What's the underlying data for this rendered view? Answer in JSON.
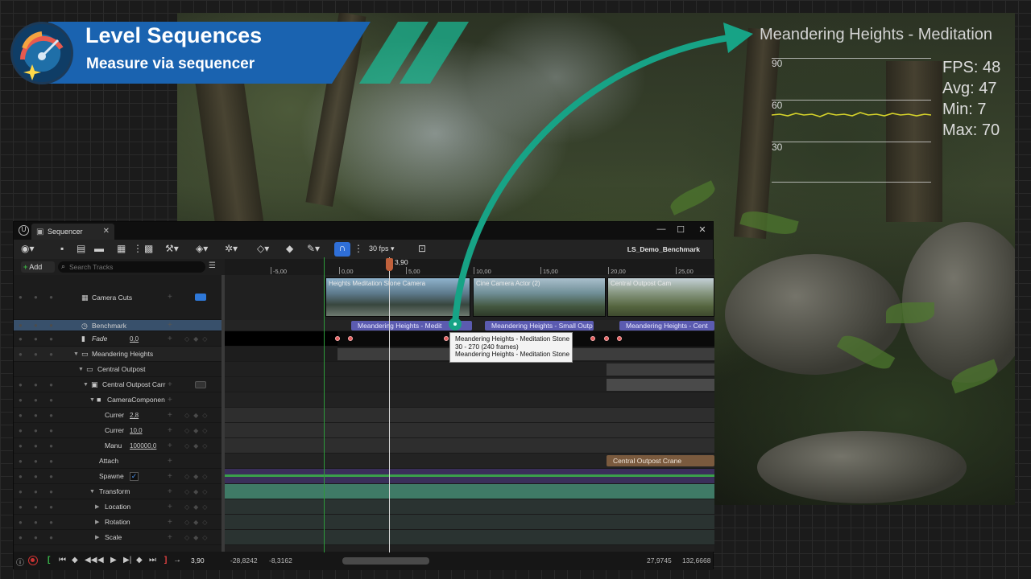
{
  "banner": {
    "title": "Level Sequences",
    "subtitle": "Measure via sequencer"
  },
  "overlay": {
    "title": "Meandering Heights - Meditation",
    "graph_labels": [
      "90",
      "60",
      "30"
    ],
    "stats": [
      "FPS: 48",
      "Avg: 47",
      "Min: 7",
      "Max: 70"
    ],
    "graph_color": "#d6d32a"
  },
  "sequencer": {
    "tab_label": "Sequencer",
    "fps_label": "30 fps",
    "sequence_name": "LS_Demo_Benchmark",
    "add_label": "Add",
    "search_placeholder": "Search Tracks",
    "ruler_ticks": [
      "-5,00",
      "0,00",
      "5,00",
      "10,00",
      "15,00",
      "20,00",
      "25,00"
    ],
    "playhead_time": "3,90",
    "tracks": [
      {
        "label": "Camera Cuts"
      },
      {
        "label": "Benchmark"
      },
      {
        "label": "Fade",
        "value": "0,0"
      },
      {
        "label": "Meandering Heights"
      },
      {
        "label": "Central Outpost"
      },
      {
        "label": "Central Outpost Carr"
      },
      {
        "label": "CameraComponen"
      },
      {
        "label": "Currer",
        "value": "2,8"
      },
      {
        "label": "Currer",
        "value": "10,0"
      },
      {
        "label": "Manu",
        "value": "100000,0"
      },
      {
        "label": "Attach"
      },
      {
        "label": "Spawne"
      },
      {
        "label": "Transform"
      },
      {
        "label": "Location"
      },
      {
        "label": "Rotation"
      },
      {
        "label": "Scale"
      }
    ],
    "shots": [
      "Heights Meditation Stone Camera",
      "Cine Camera Actor (2)",
      "Central Outpost Cam"
    ],
    "benchmark_clips": [
      "Meandering Heights - Medit",
      "Meandering Heights - Small Outp",
      "Meandering Heights - Cent"
    ],
    "attach_clip": "Central Outpost Crane",
    "tooltip": {
      "line1": "Meandering Heights - Meditation Stone",
      "line2": "30 - 270 (240 frames)",
      "line3": "Meandering Heights - Meditation Stone"
    },
    "transport": {
      "current_time": "3,90",
      "view_start": "-28,8242",
      "view_start2": "-8,3162",
      "view_end": "27,9745",
      "view_end2": "132,6668"
    },
    "colors": {
      "accent_blue": "#2f6fd8",
      "benchmark_clip": "#5b5bb0",
      "arrow": "#17a386"
    }
  }
}
